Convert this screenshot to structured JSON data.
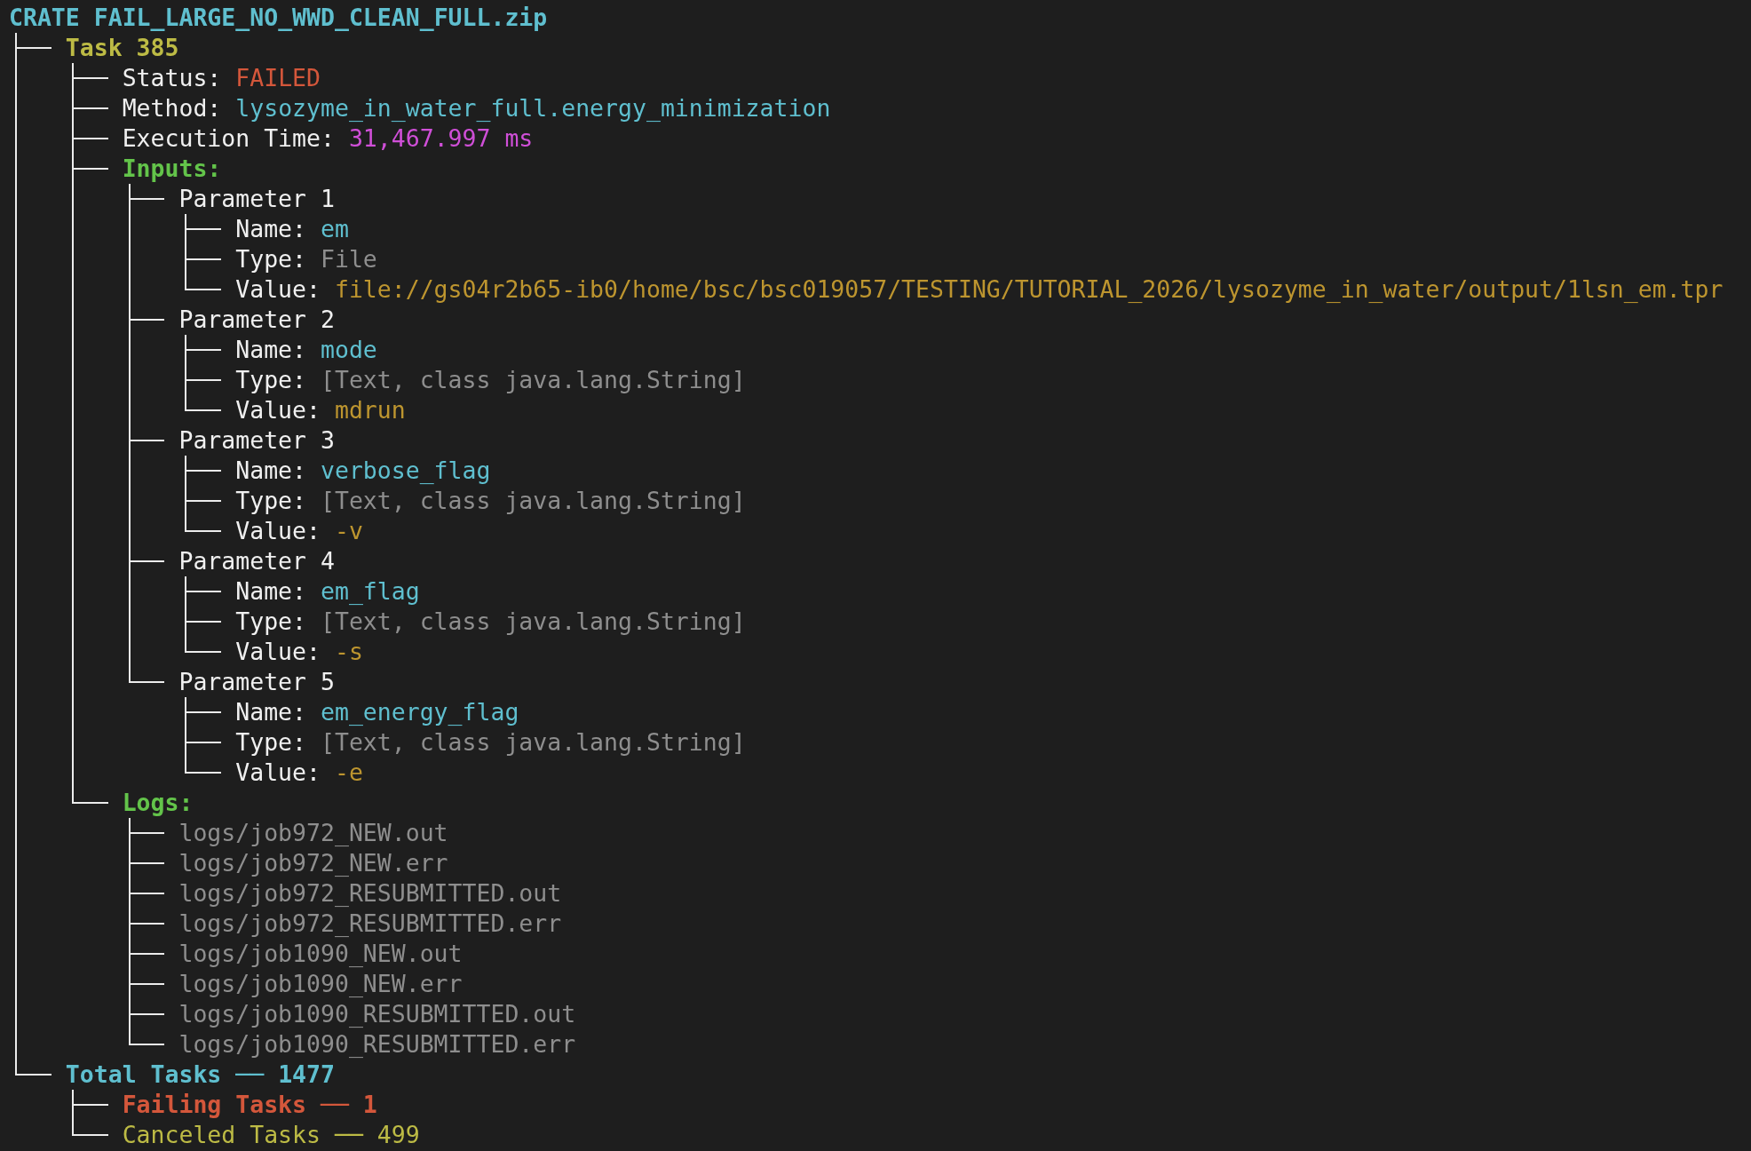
{
  "archive": {
    "title": "CRATE FAIL_LARGE_NO_WWD_CLEAN_FULL.zip",
    "children": [
      {
        "kind": "task",
        "text": "Task 385",
        "children": [
          {
            "kind": "status",
            "label": "Status:",
            "value": "FAILED"
          },
          {
            "kind": "method",
            "label": "Method:",
            "value": "lysozyme_in_water_full.energy_minimization"
          },
          {
            "kind": "time",
            "label": "Execution Time:",
            "value": "31,467.997 ms"
          },
          {
            "kind": "section",
            "text": "Inputs:",
            "children": [
              {
                "kind": "parameter",
                "text": "Parameter 1",
                "children": [
                  {
                    "kind": "name",
                    "label": "Name:",
                    "value": "em"
                  },
                  {
                    "kind": "type",
                    "label": "Type:",
                    "value": "File"
                  },
                  {
                    "kind": "value",
                    "label": "Value:",
                    "value": "file://gs04r2b65-ib0/home/bsc/bsc019057/TESTING/TUTORIAL_2026/lysozyme_in_water/output/1lsn_em.tpr"
                  }
                ]
              },
              {
                "kind": "parameter",
                "text": "Parameter 2",
                "children": [
                  {
                    "kind": "name",
                    "label": "Name:",
                    "value": "mode"
                  },
                  {
                    "kind": "type",
                    "label": "Type:",
                    "value": "[Text, class java.lang.String]"
                  },
                  {
                    "kind": "value",
                    "label": "Value:",
                    "value": "mdrun"
                  }
                ]
              },
              {
                "kind": "parameter",
                "text": "Parameter 3",
                "children": [
                  {
                    "kind": "name",
                    "label": "Name:",
                    "value": "verbose_flag"
                  },
                  {
                    "kind": "type",
                    "label": "Type:",
                    "value": "[Text, class java.lang.String]"
                  },
                  {
                    "kind": "value",
                    "label": "Value:",
                    "value": "-v"
                  }
                ]
              },
              {
                "kind": "parameter",
                "text": "Parameter 4",
                "children": [
                  {
                    "kind": "name",
                    "label": "Name:",
                    "value": "em_flag"
                  },
                  {
                    "kind": "type",
                    "label": "Type:",
                    "value": "[Text, class java.lang.String]"
                  },
                  {
                    "kind": "value",
                    "label": "Value:",
                    "value": "-s"
                  }
                ]
              },
              {
                "kind": "parameter",
                "text": "Parameter 5",
                "children": [
                  {
                    "kind": "name",
                    "label": "Name:",
                    "value": "em_energy_flag"
                  },
                  {
                    "kind": "type",
                    "label": "Type:",
                    "value": "[Text, class java.lang.String]"
                  },
                  {
                    "kind": "value",
                    "label": "Value:",
                    "value": "-e"
                  }
                ]
              }
            ]
          },
          {
            "kind": "section",
            "text": "Logs:",
            "children": [
              {
                "kind": "log",
                "text": "logs/job972_NEW.out"
              },
              {
                "kind": "log",
                "text": "logs/job972_NEW.err"
              },
              {
                "kind": "log",
                "text": "logs/job972_RESUBMITTED.out"
              },
              {
                "kind": "log",
                "text": "logs/job972_RESUBMITTED.err"
              },
              {
                "kind": "log",
                "text": "logs/job1090_NEW.out"
              },
              {
                "kind": "log",
                "text": "logs/job1090_NEW.err"
              },
              {
                "kind": "log",
                "text": "logs/job1090_RESUBMITTED.out"
              },
              {
                "kind": "log",
                "text": "logs/job1090_RESUBMITTED.err"
              }
            ]
          }
        ]
      },
      {
        "kind": "total",
        "text": "Total Tasks ── 1477",
        "children": [
          {
            "kind": "failing",
            "text": "Failing Tasks ── 1"
          },
          {
            "kind": "canceled",
            "text": "Canceled Tasks ── 499"
          }
        ]
      }
    ]
  }
}
